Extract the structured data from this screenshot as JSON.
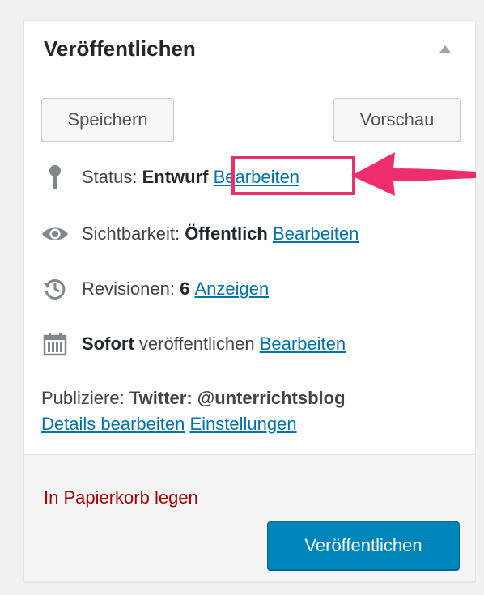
{
  "panel": {
    "title": "Veröffentlichen",
    "save_label": "Speichern",
    "preview_label": "Vorschau",
    "status": {
      "label": "Status:",
      "value": "Entwurf",
      "link": "Bearbeiten"
    },
    "visibility": {
      "label": "Sichtbarkeit:",
      "value": "Öffentlich",
      "link": "Bearbeiten"
    },
    "revisions": {
      "label": "Revisionen:",
      "value": "6",
      "link": "Anzeigen"
    },
    "schedule": {
      "value": "Sofort",
      "label": "veröffentlichen",
      "link": "Bearbeiten"
    },
    "publicize": {
      "label": "Publiziere:",
      "value": "Twitter: @unterrichtsblog",
      "details_link": "Details bearbeiten",
      "settings_link": "Einstellungen"
    },
    "trash_label": "In Papierkorb legen",
    "publish_label": "Veröffentlichen"
  },
  "colors": {
    "link": "#0073aa",
    "trash": "#a00000",
    "primary_button": "#0085ba",
    "highlight": "#ee2d6e"
  },
  "icons": [
    "pin-icon",
    "eye-icon",
    "history-icon",
    "calendar-icon",
    "collapse-arrow-icon"
  ]
}
